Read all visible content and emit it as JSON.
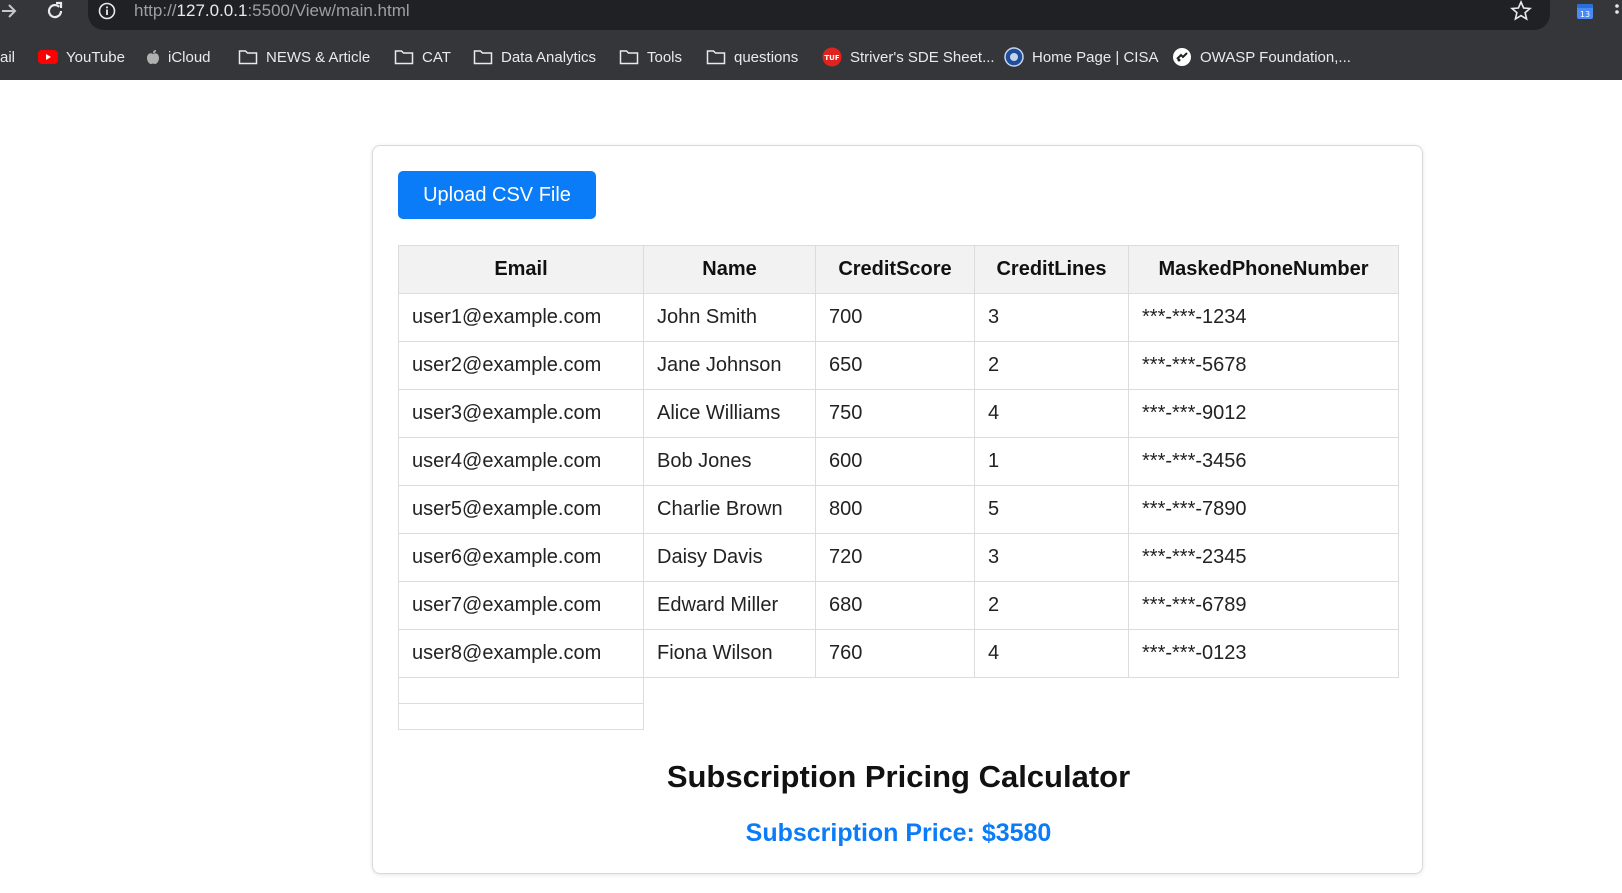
{
  "browser": {
    "url_prefix": "http://",
    "url_host": "127.0.0.1",
    "url_rest": ":5500/View/main.html",
    "bookmarks": [
      {
        "label": "ail",
        "icon": "none"
      },
      {
        "label": "YouTube",
        "icon": "youtube-icon"
      },
      {
        "label": "iCloud",
        "icon": "apple-icon"
      },
      {
        "label": "NEWS & Article",
        "icon": "folder-icon"
      },
      {
        "label": "CAT",
        "icon": "folder-icon"
      },
      {
        "label": "Data Analytics",
        "icon": "folder-icon"
      },
      {
        "label": "Tools",
        "icon": "folder-icon"
      },
      {
        "label": "questions",
        "icon": "folder-icon"
      },
      {
        "label": "Striver's SDE Sheet...",
        "icon": "tuf-icon"
      },
      {
        "label": "Home Page | CISA",
        "icon": "cisa-icon"
      },
      {
        "label": "OWASP Foundation,...",
        "icon": "owasp-icon"
      }
    ]
  },
  "page": {
    "upload_label": "Upload CSV File",
    "table": {
      "columns": [
        "Email",
        "Name",
        "CreditScore",
        "CreditLines",
        "MaskedPhoneNumber"
      ],
      "rows": [
        [
          "user1@example.com",
          "John Smith",
          "700",
          "3",
          "***-***-1234"
        ],
        [
          "user2@example.com",
          "Jane Johnson",
          "650",
          "2",
          "***-***-5678"
        ],
        [
          "user3@example.com",
          "Alice Williams",
          "750",
          "4",
          "***-***-9012"
        ],
        [
          "user4@example.com",
          "Bob Jones",
          "600",
          "1",
          "***-***-3456"
        ],
        [
          "user5@example.com",
          "Charlie Brown",
          "800",
          "5",
          "***-***-7890"
        ],
        [
          "user6@example.com",
          "Daisy Davis",
          "720",
          "3",
          "***-***-2345"
        ],
        [
          "user7@example.com",
          "Edward Miller",
          "680",
          "2",
          "***-***-6789"
        ],
        [
          "user8@example.com",
          "Fiona Wilson",
          "760",
          "4",
          "***-***-0123"
        ]
      ]
    },
    "calculator_title": "Subscription Pricing Calculator",
    "price_text": "Subscription Price: $3580"
  },
  "colors": {
    "accent": "#0a7cf7",
    "chrome": "#35363a",
    "omnibox": "#202124"
  }
}
